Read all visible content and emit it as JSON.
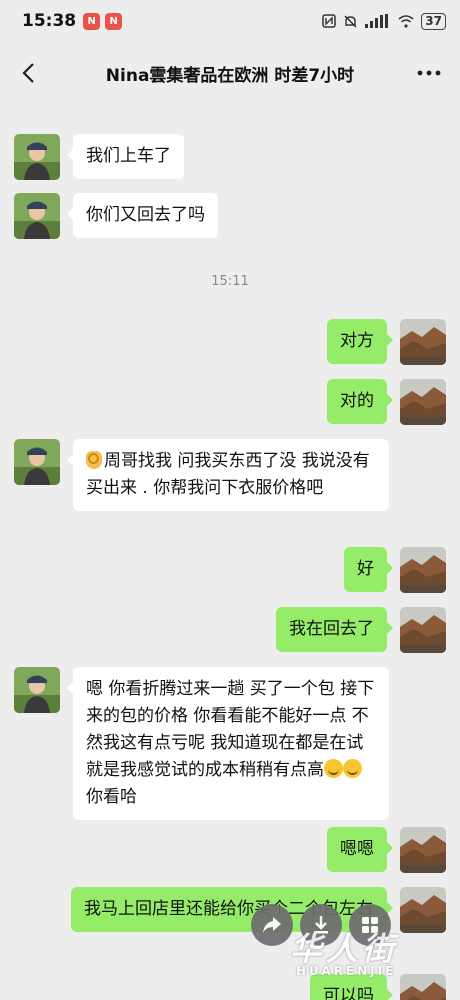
{
  "status_bar": {
    "time": "15:38",
    "notifications": [
      "N",
      "N"
    ],
    "battery": "37"
  },
  "header": {
    "title": "Nina雲集奢品在欧洲 时差7小时"
  },
  "messages": [
    {
      "type": "timestamp",
      "text": "15:11"
    },
    {
      "type": "in",
      "text": "我们上车了"
    },
    {
      "type": "in",
      "text": "你们又回去了吗"
    },
    {
      "type": "out",
      "text": "对方"
    },
    {
      "type": "out",
      "text": "对的"
    },
    {
      "type": "in",
      "text": "周哥找我 问我买东西了没 我说没有买出来 . 你帮我问下衣服价格吧"
    },
    {
      "type": "out",
      "text": "好"
    },
    {
      "type": "out",
      "text": "我在回去了"
    },
    {
      "type": "in",
      "text": "嗯 你看折腾过来一趟 买了一个包 接下来的包的价格 你看看能不能好一点 不然我这有点亏呢 我知道现在都是在试 就是我感觉试的成本稍稍有点高",
      "text_after_emoji": "你看哈"
    },
    {
      "type": "out",
      "text": "嗯嗯"
    },
    {
      "type": "out",
      "text": "我马上回店里还能给你买个二个包左右"
    },
    {
      "type": "out",
      "text": "可以吗"
    }
  ],
  "floating_actions": [
    "share-icon",
    "download-icon",
    "grid-icon"
  ],
  "watermark": {
    "cn": "华人街",
    "en": "HUARENJIE"
  },
  "colors": {
    "background": "#ededed",
    "bubble_out": "#95ec69",
    "bubble_in": "#ffffff"
  }
}
